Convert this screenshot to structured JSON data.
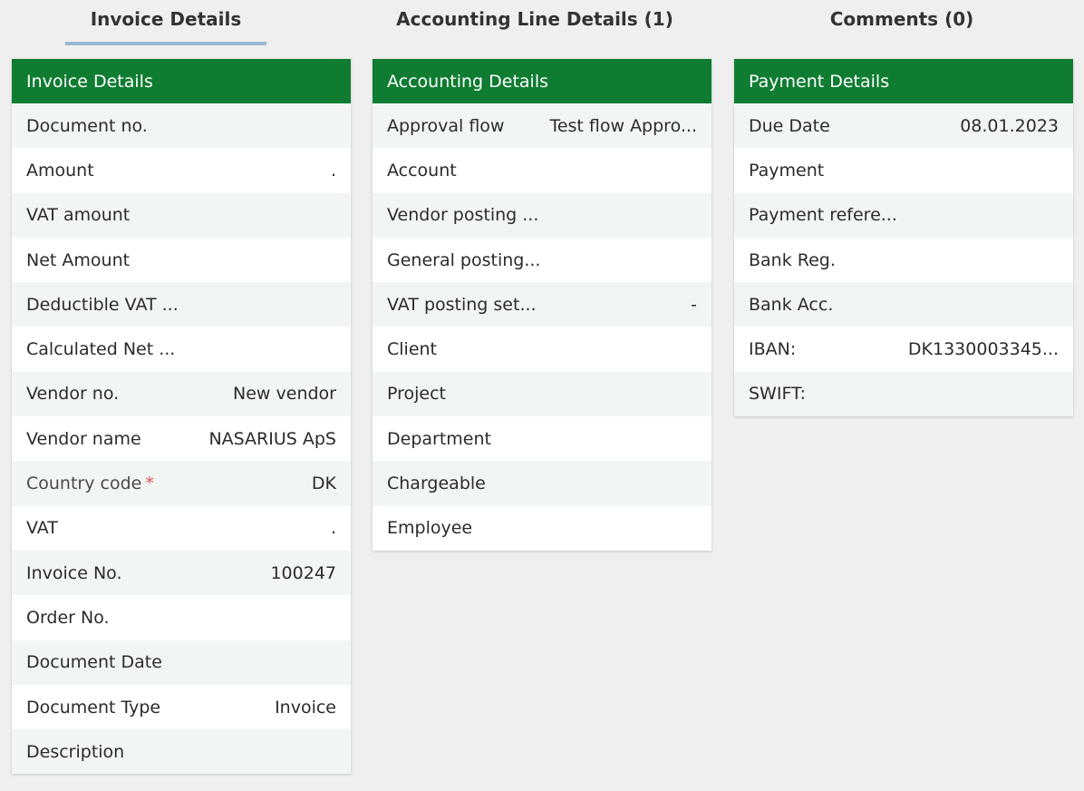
{
  "tabs": [
    {
      "label": "Invoice Details",
      "count": ""
    },
    {
      "label": "Accounting Line Details",
      "count": "(1)"
    },
    {
      "label": "Comments",
      "count": "(0)"
    }
  ],
  "invoice_card": {
    "title": "Invoice Details",
    "rows": [
      {
        "label": "Document no.",
        "value": ""
      },
      {
        "label": "Amount",
        "value": "."
      },
      {
        "label": "VAT amount",
        "value": ""
      },
      {
        "label": "Net Amount",
        "value": ""
      },
      {
        "label": "Deductible VAT ...",
        "value": ""
      },
      {
        "label": "Calculated Net ...",
        "value": ""
      },
      {
        "label": "Vendor no.",
        "value": "New vendor"
      },
      {
        "label": "Vendor name",
        "value": "NASARIUS ApS"
      },
      {
        "label": "Country code",
        "value": "DK",
        "required_mark": "*"
      },
      {
        "label": "VAT",
        "value": "."
      },
      {
        "label": "Invoice No.",
        "value": "100247"
      },
      {
        "label": "Order No.",
        "value": ""
      },
      {
        "label": "Document Date",
        "value": ""
      },
      {
        "label": "Document Type",
        "value": "Invoice"
      },
      {
        "label": "Description",
        "value": ""
      }
    ]
  },
  "accounting_card": {
    "title": "Accounting Details",
    "rows": [
      {
        "label": "Approval flow",
        "value": "Test flow Appro..."
      },
      {
        "label": "Account",
        "value": ""
      },
      {
        "label": "Vendor posting ...",
        "value": ""
      },
      {
        "label": "General posting...",
        "value": ""
      },
      {
        "label": "VAT posting set...",
        "value": "-"
      },
      {
        "label": "Client",
        "value": ""
      },
      {
        "label": "Project",
        "value": ""
      },
      {
        "label": "Department",
        "value": ""
      },
      {
        "label": "Chargeable",
        "value": ""
      },
      {
        "label": "Employee",
        "value": ""
      }
    ]
  },
  "payment_card": {
    "title": "Payment Details",
    "rows": [
      {
        "label": "Due Date",
        "value": "08.01.2023"
      },
      {
        "label": "Payment",
        "value": ""
      },
      {
        "label": "Payment refere...",
        "value": ""
      },
      {
        "label": "Bank Reg.",
        "value": ""
      },
      {
        "label": "Bank Acc.",
        "value": ""
      },
      {
        "label": "IBAN:",
        "value": "DK1330003345..."
      },
      {
        "label": "SWIFT:",
        "value": ""
      }
    ]
  },
  "colors": {
    "header_green": "#0f7c32",
    "active_tab_underline": "#9ab8d6",
    "required_star": "#d9534f",
    "row_alt": "#f1f6f4"
  }
}
